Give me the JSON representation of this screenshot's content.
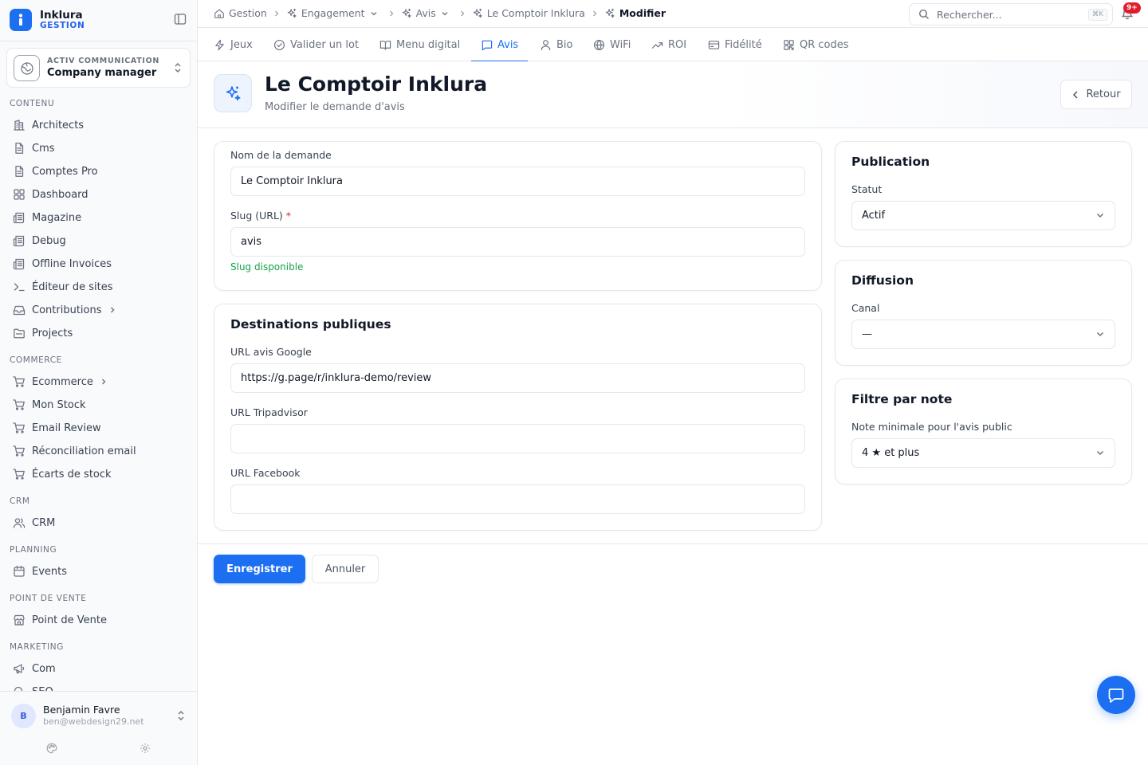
{
  "brand": {
    "name": "Inklura",
    "sub": "GESTION"
  },
  "company": {
    "org": "ACTIV COMMUNICATION",
    "name": "Company manager"
  },
  "sidebar": {
    "sections": [
      {
        "label": "CONTENU",
        "items": [
          {
            "label": "Architects",
            "icon": "building-icon"
          },
          {
            "label": "Cms",
            "icon": "file-icon"
          },
          {
            "label": "Comptes Pro",
            "icon": "file-icon"
          },
          {
            "label": "Dashboard",
            "icon": "grid-icon"
          },
          {
            "label": "Magazine",
            "icon": "newspaper-icon"
          },
          {
            "label": "Debug",
            "icon": "newspaper-icon"
          },
          {
            "label": "Offline Invoices",
            "icon": "newspaper-icon"
          },
          {
            "label": "Éditeur de sites",
            "icon": "terminal-icon"
          },
          {
            "label": "Contributions",
            "icon": "inbox-icon",
            "chevron": true
          },
          {
            "label": "Projects",
            "icon": "folder-icon"
          }
        ]
      },
      {
        "label": "COMMERCE",
        "items": [
          {
            "label": "Ecommerce",
            "icon": "cart-icon",
            "chevron": true
          },
          {
            "label": "Mon Stock",
            "icon": "cart-icon"
          },
          {
            "label": "Email Review",
            "icon": "cart-icon"
          },
          {
            "label": "Réconciliation email",
            "icon": "cart-icon"
          },
          {
            "label": "Écarts de stock",
            "icon": "cart-icon"
          }
        ]
      },
      {
        "label": "CRM",
        "items": [
          {
            "label": "CRM",
            "icon": "users-icon"
          }
        ]
      },
      {
        "label": "PLANNING",
        "items": [
          {
            "label": "Events",
            "icon": "calendar-icon"
          }
        ]
      },
      {
        "label": "POINT DE VENTE",
        "items": [
          {
            "label": "Point de Vente",
            "icon": "store-icon"
          }
        ]
      },
      {
        "label": "MARKETING",
        "items": [
          {
            "label": "Com",
            "icon": "megaphone-icon"
          },
          {
            "label": "SEO",
            "icon": "search-icon"
          }
        ]
      }
    ]
  },
  "user": {
    "initial": "B",
    "name": "Benjamin Favre",
    "email": "ben@webdesign29.net"
  },
  "breadcrumbs": [
    {
      "label": "Gestion",
      "icon": "home-icon"
    },
    {
      "label": "Engagement",
      "icon": "sparkles-icon",
      "dropdown": true
    },
    {
      "label": "Avis",
      "icon": "sparkles-icon",
      "dropdown": true
    },
    {
      "label": "Le Comptoir Inklura",
      "icon": "sparkles-icon"
    },
    {
      "label": "Modifier",
      "icon": "sparkles-icon",
      "current": true
    }
  ],
  "search": {
    "placeholder": "Rechercher...",
    "shortcut": "⌘K"
  },
  "notifications": {
    "badge": "9+"
  },
  "tabs": [
    {
      "label": "Jeux",
      "icon": "zap-icon"
    },
    {
      "label": "Valider un lot",
      "icon": "check-circle-icon"
    },
    {
      "label": "Menu digital",
      "icon": "book-icon"
    },
    {
      "label": "Avis",
      "icon": "message-icon",
      "active": true
    },
    {
      "label": "Bio",
      "icon": "user-icon"
    },
    {
      "label": "WiFi",
      "icon": "globe-icon"
    },
    {
      "label": "ROI",
      "icon": "trending-icon"
    },
    {
      "label": "Fidélité",
      "icon": "card-icon"
    },
    {
      "label": "QR codes",
      "icon": "qr-icon"
    }
  ],
  "header": {
    "title": "Le Comptoir Inklura",
    "subtitle": "Modifier le demande d'avis",
    "back_label": "Retour"
  },
  "form": {
    "name_label": "Nom de la demande",
    "name_value": "Le Comptoir Inklura",
    "slug_label": "Slug (URL)",
    "slug_required": "*",
    "slug_value": "avis",
    "slug_status": "Slug disponible"
  },
  "destinations": {
    "title": "Destinations publiques",
    "google_label": "URL avis Google",
    "google_value": "https://g.page/r/inklura-demo/review",
    "tripadvisor_label": "URL Tripadvisor",
    "tripadvisor_value": "",
    "facebook_label": "URL Facebook",
    "facebook_value": ""
  },
  "publication": {
    "title": "Publication",
    "status_label": "Statut",
    "status_value": "Actif"
  },
  "diffusion": {
    "title": "Diffusion",
    "channel_label": "Canal",
    "channel_value": "—"
  },
  "rating_filter": {
    "title": "Filtre par note",
    "min_label": "Note minimale pour l'avis public",
    "min_value": "4 ★ et plus"
  },
  "actions": {
    "save": "Enregistrer",
    "cancel": "Annuler"
  },
  "colors": {
    "accent": "#1d6ff2",
    "success": "#16a34a",
    "danger": "#e11d2d",
    "required": "#dc2626"
  }
}
